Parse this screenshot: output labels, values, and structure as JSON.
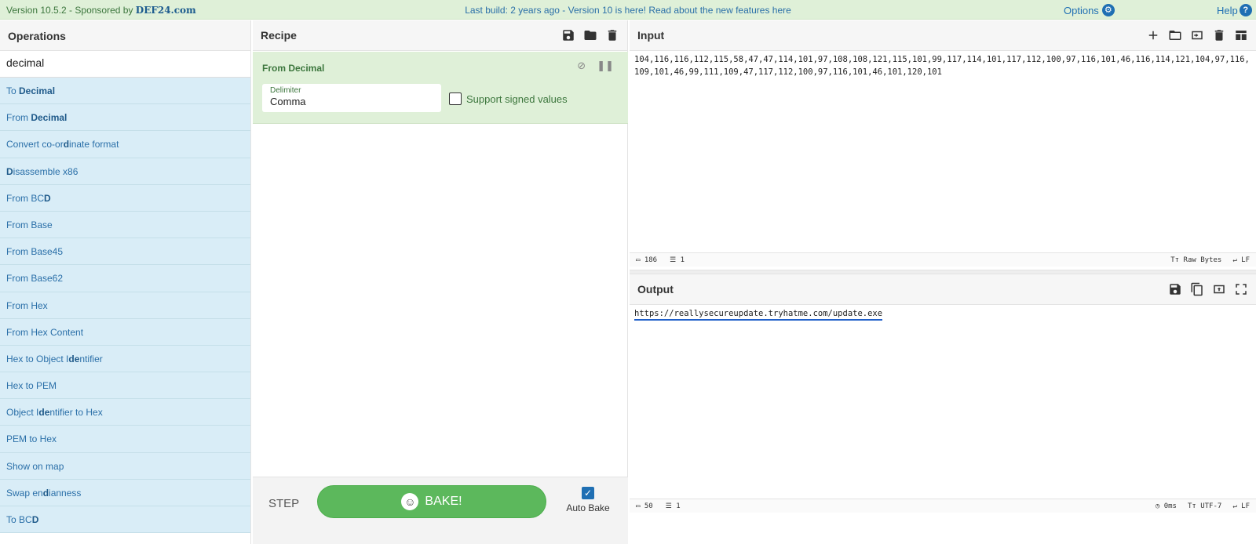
{
  "banner": {
    "version": "Version 10.5.2 - Sponsored by",
    "sponsor": "DEF24.com",
    "message": "Last build: 2 years ago - Version 10 is here! Read about the new features here",
    "options": "Options",
    "help": "Help"
  },
  "operations": {
    "title": "Operations",
    "search": "decimal",
    "items": [
      {
        "pre": "To ",
        "bold": "Decimal",
        "post": ""
      },
      {
        "pre": "From ",
        "bold": "Decimal",
        "post": ""
      },
      {
        "pre": "Convert co-or",
        "bold": "d",
        "post": "inate format"
      },
      {
        "pre": "",
        "bold": "D",
        "post": "isassemble x86"
      },
      {
        "pre": "From BC",
        "bold": "D",
        "post": ""
      },
      {
        "pre": "From Base",
        "bold": "",
        "post": ""
      },
      {
        "pre": "From Base45",
        "bold": "",
        "post": ""
      },
      {
        "pre": "From Base62",
        "bold": "",
        "post": ""
      },
      {
        "pre": "From Hex",
        "bold": "",
        "post": ""
      },
      {
        "pre": "From Hex Content",
        "bold": "",
        "post": ""
      },
      {
        "pre": "Hex to Object I",
        "bold": "de",
        "post": "ntifier"
      },
      {
        "pre": "Hex to PEM",
        "bold": "",
        "post": ""
      },
      {
        "pre": "Object I",
        "bold": "de",
        "post": "ntifier to Hex"
      },
      {
        "pre": "PEM to Hex",
        "bold": "",
        "post": ""
      },
      {
        "pre": "Show on map",
        "bold": "",
        "post": ""
      },
      {
        "pre": "Swap en",
        "bold": "d",
        "post": "ianness"
      },
      {
        "pre": "To BC",
        "bold": "D",
        "post": ""
      }
    ]
  },
  "recipe": {
    "title": "Recipe",
    "op_title": "From Decimal",
    "delimiter_label": "Delimiter",
    "delimiter_value": "Comma",
    "signed_label": "Support signed values",
    "step": "STEP",
    "bake": "BAKE!",
    "auto_bake": "Auto Bake"
  },
  "input": {
    "title": "Input",
    "text": "104,116,116,112,115,58,47,47,114,101,97,108,108,121,115,101,99,117,114,101,117,112,100,97,116,101,46,116,114,121,104,97,116,109,101,46,99,111,109,47,117,112,100,97,116,101,46,101,120,101",
    "chars": "186",
    "lines": "1",
    "encoding": "Raw Bytes",
    "eol": "LF"
  },
  "output": {
    "title": "Output",
    "text": "https://reallysecureupdate.tryhatme.com/update.exe",
    "chars": "50",
    "lines": "1",
    "time": "0ms",
    "encoding": "UTF-7",
    "eol": "LF"
  }
}
